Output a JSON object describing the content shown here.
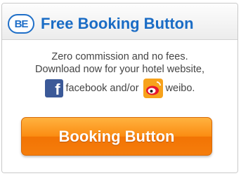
{
  "header": {
    "logo_text": "BE",
    "title": "Free Booking Button"
  },
  "description": {
    "line1": "Zero commission and no fees.",
    "line2": "Download now for your hotel website,"
  },
  "social": {
    "facebook_glyph": "f",
    "facebook_label": "facebook and/or",
    "weibo_label": "weibo."
  },
  "button": {
    "label": "Booking Button"
  },
  "colors": {
    "title_blue": "#1a6cc5",
    "button_orange": "#f57d0c",
    "facebook_blue": "#3b5998",
    "weibo_orange": "#f7a21b"
  }
}
